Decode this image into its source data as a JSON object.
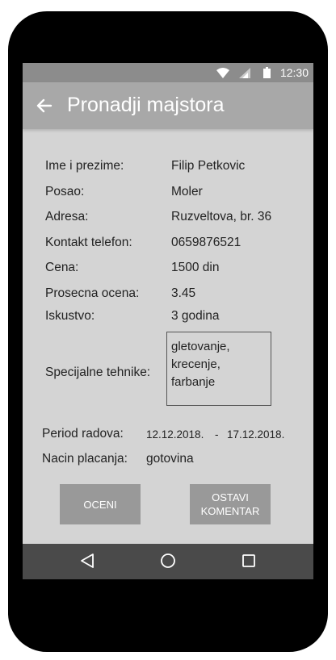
{
  "status_bar": {
    "time": "12:30",
    "icons": [
      "wifi-icon",
      "signal-icon",
      "battery-icon"
    ]
  },
  "app_bar": {
    "title": "Pronadji majstora",
    "back_icon": "back-arrow-icon"
  },
  "details": {
    "name_label": "Ime i prezime:",
    "name_value": "Filip Petkovic",
    "job_label": "Posao:",
    "job_value": "Moler",
    "address_label": "Adresa:",
    "address_value": "Ruzveltova, br. 36",
    "phone_label": "Kontakt telefon:",
    "phone_value": "0659876521",
    "price_label": "Cena:",
    "price_value": "1500 din",
    "rating_label": "Prosecna ocena:",
    "rating_value": "3.45",
    "experience_label": "Iskustvo:",
    "experience_value": "3 godina",
    "techniques_label": "Specijalne tehnike:",
    "techniques": [
      "gletovanje,",
      "krecenje,",
      "farbanje"
    ]
  },
  "period": {
    "label": "Period radova:",
    "start": "12.12.2018.",
    "separator": "-",
    "end": "17.12.2018."
  },
  "payment": {
    "label": "Nacin placanja:",
    "value": "gotovina"
  },
  "actions": {
    "rate_label": "OCENI",
    "comment_line1": "OSTAVI",
    "comment_line2": "KOMENTAR"
  },
  "nav_bar": {
    "icons": [
      "back-triangle-icon",
      "home-circle-icon",
      "recents-square-icon"
    ]
  },
  "colors": {
    "screen_bg": "#d4d4d4",
    "app_bar": "#a8a8a8",
    "status_bar": "#8c8c8c",
    "nav_bar": "#4a4a4a",
    "button": "#999999"
  }
}
